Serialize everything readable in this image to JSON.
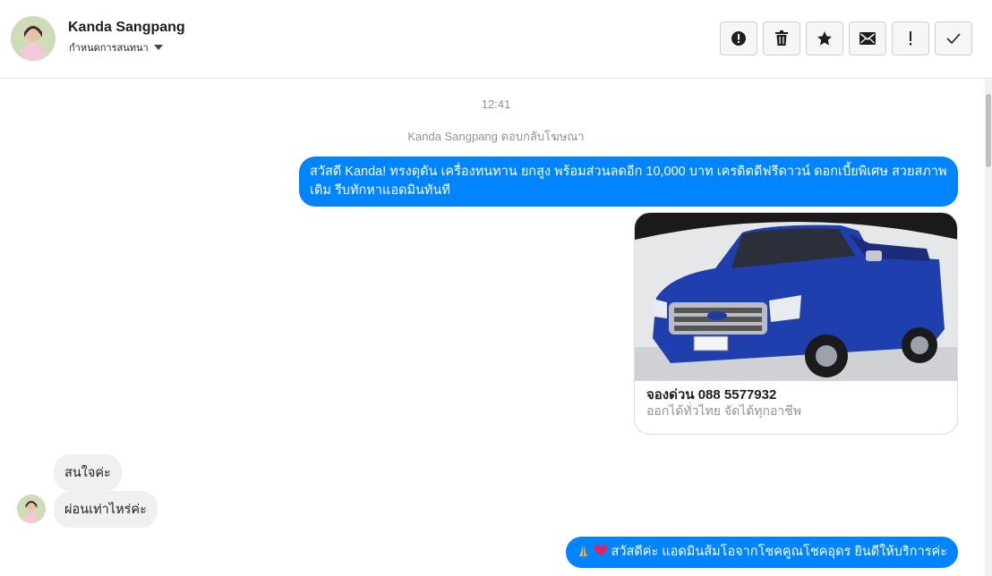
{
  "header": {
    "contact_name": "Kanda Sangpang",
    "label_select": "กำหนดการสนทนา",
    "actions": [
      {
        "name": "spam",
        "icon": "alert-circle-icon"
      },
      {
        "name": "delete",
        "icon": "trash-icon"
      },
      {
        "name": "star",
        "icon": "star-icon"
      },
      {
        "name": "unread",
        "icon": "envelope-icon"
      },
      {
        "name": "follow-up",
        "icon": "exclamation-icon"
      },
      {
        "name": "done",
        "icon": "check-icon"
      }
    ]
  },
  "thread": {
    "time": "12:41",
    "system_note": "Kanda Sangpang ตอบกลับโฆษณา",
    "outgoing_1": "สวัสดี Kanda!  ทรงดุดัน เครื่องทนทาน ยกสูง พร้อมส่วนลดอีก 10,000 บาท เครดิตดีฟรีดาวน์ ดอกเบี้ยพิเศษ สวยสภาพเดิม รีบทักหาแอดมินทันที",
    "card": {
      "title": "จองด่วน 088 5577932",
      "subtitle": "ออกได้ทั่วไทย จัดได้ทุกอาชีพ",
      "image_icon": "blue-pickup-truck-photo"
    },
    "incoming_1": "สนใจค่ะ",
    "incoming_2": "ผ่อนเท่าไหร่ค่ะ",
    "outgoing_2": "สวัสดีค่ะ แอดมินส้มโอจากโชคคูณโชคอุดร ยินดีให้บริการค่ะ",
    "outgoing_2_emojis": [
      "folded-hands-icon",
      "red-heart-icon"
    ]
  },
  "colors": {
    "outgoing_bubble": "#0084ff",
    "incoming_bubble": "#f1f0f0",
    "muted_text": "#8d949e"
  }
}
